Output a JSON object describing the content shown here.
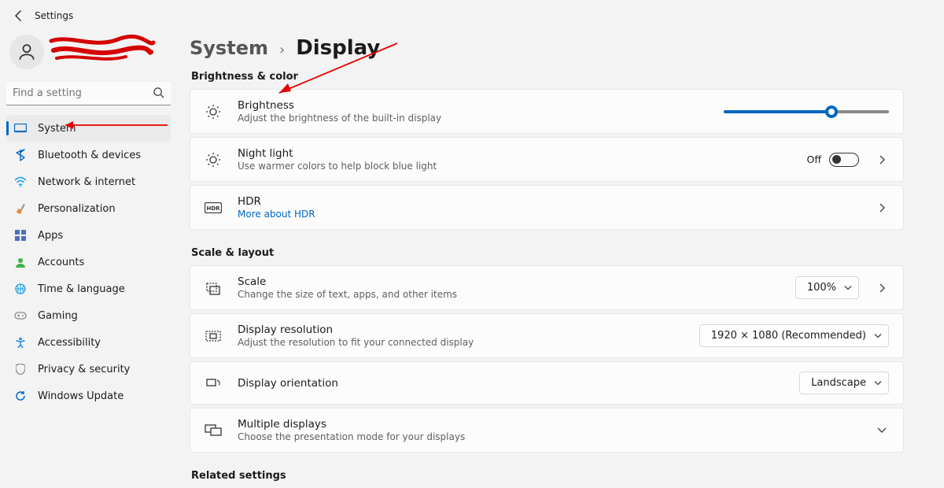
{
  "window": {
    "title": "Settings"
  },
  "search": {
    "placeholder": "Find a setting"
  },
  "sidebar": {
    "items": [
      {
        "label": "System",
        "icon_color": "#0067c0",
        "selected": true
      },
      {
        "label": "Bluetooth & devices",
        "icon_color": "#0067c0"
      },
      {
        "label": "Network & internet",
        "icon_color": "#1aa0e8"
      },
      {
        "label": "Personalization",
        "icon_color": "#e8873a"
      },
      {
        "label": "Apps",
        "icon_color": "#4c6fbf"
      },
      {
        "label": "Accounts",
        "icon_color": "#39b54a"
      },
      {
        "label": "Time & language",
        "icon_color": "#1aa0e8"
      },
      {
        "label": "Gaming",
        "icon_color": "#888888"
      },
      {
        "label": "Accessibility",
        "icon_color": "#1e88e5"
      },
      {
        "label": "Privacy & security",
        "icon_color": "#888888"
      },
      {
        "label": "Windows Update",
        "icon_color": "#0067c0"
      }
    ]
  },
  "breadcrumb": {
    "parent": "System",
    "current": "Display",
    "separator": "›"
  },
  "sections": {
    "brightness_color": {
      "heading": "Brightness & color",
      "brightness": {
        "title": "Brightness",
        "sub": "Adjust the brightness of the built-in display",
        "value_percent": 65
      },
      "night_light": {
        "title": "Night light",
        "sub": "Use warmer colors to help block blue light",
        "toggle_label": "Off",
        "toggle_on": false
      },
      "hdr": {
        "title": "HDR",
        "link": "More about HDR"
      }
    },
    "scale_layout": {
      "heading": "Scale & layout",
      "scale": {
        "title": "Scale",
        "sub": "Change the size of text, apps, and other items",
        "value": "100%"
      },
      "resolution": {
        "title": "Display resolution",
        "sub": "Adjust the resolution to fit your connected display",
        "value": "1920 × 1080 (Recommended)"
      },
      "orientation": {
        "title": "Display orientation",
        "value": "Landscape"
      },
      "multiple": {
        "title": "Multiple displays",
        "sub": "Choose the presentation mode for your displays"
      }
    },
    "related": {
      "heading": "Related settings"
    }
  }
}
